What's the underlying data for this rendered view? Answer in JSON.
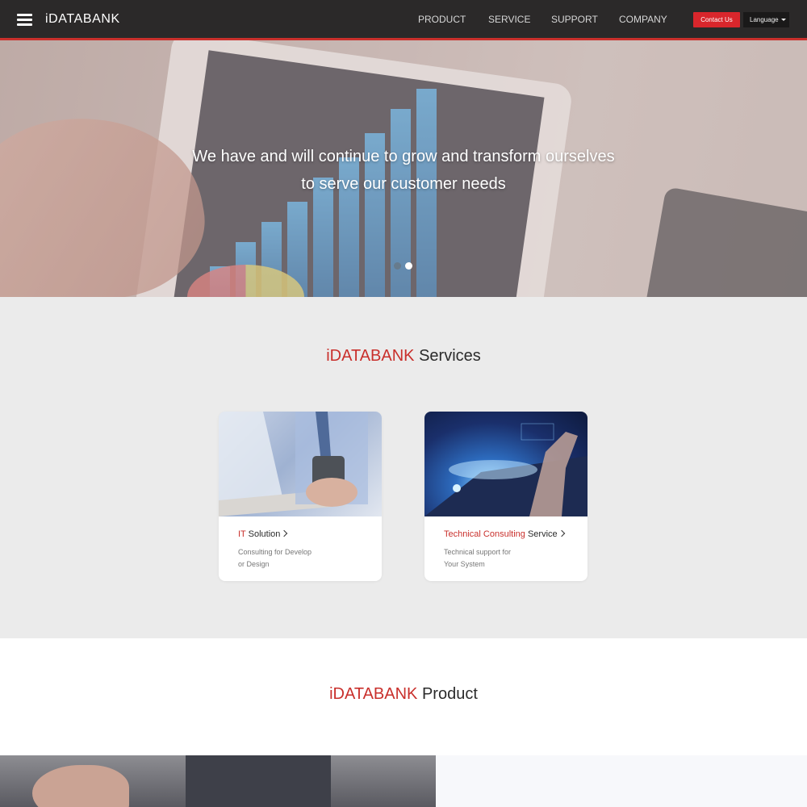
{
  "header": {
    "logo": "iDATABANK",
    "nav": [
      "PRODUCT",
      "SERVICE",
      "SUPPORT",
      "COMPANY"
    ],
    "contact_label": "Contact Us",
    "language_label": "Language"
  },
  "hero": {
    "line1": "We have and will continue to grow and transform ourselves",
    "line2": "to serve our customer needs",
    "slides": 2,
    "active_slide": 2
  },
  "services": {
    "title_brand": "iDATABANK",
    "title_rest": " Services",
    "cards": [
      {
        "title_accent": "IT",
        "title_rest": " Solution",
        "desc1": "Consulting for Develop",
        "desc2": "or Design"
      },
      {
        "title_accent": "Technical Consulting",
        "title_rest": " Service",
        "desc1": "Technical support for",
        "desc2": "Your System"
      }
    ]
  },
  "product": {
    "title_brand": "iDATABANK",
    "title_rest": " Product"
  }
}
